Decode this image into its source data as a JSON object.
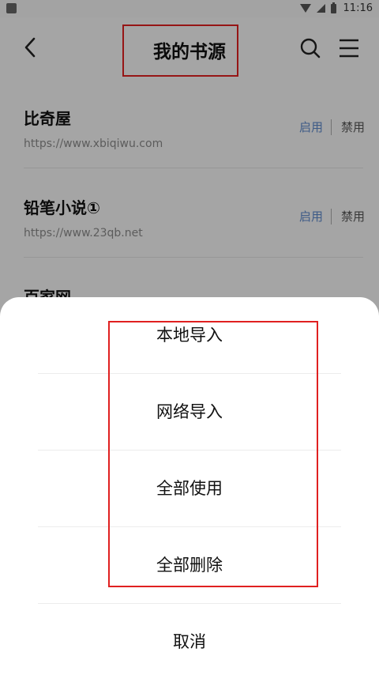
{
  "status_bar": {
    "time": "11:16"
  },
  "header": {
    "title": "我的书源"
  },
  "sources": [
    {
      "name": "比奇屋",
      "url": "https://www.xbiqiwu.com",
      "enable_label": "启用",
      "disable_label": "禁用"
    },
    {
      "name": "铅笔小说①",
      "url": "https://www.23qb.net",
      "enable_label": "启用",
      "disable_label": "禁用"
    },
    {
      "name": "百家网"
    }
  ],
  "sheet": {
    "options": [
      "本地导入",
      "网络导入",
      "全部使用",
      "全部删除"
    ],
    "cancel": "取消"
  },
  "colors": {
    "accent": "#5d88c9",
    "highlight_box": "#e02020",
    "overlay": "rgba(0,0,0,0.33)"
  },
  "icons": [
    "back-icon",
    "search-icon",
    "menu-icon",
    "wifi-icon",
    "signal-icon",
    "battery-icon"
  ]
}
